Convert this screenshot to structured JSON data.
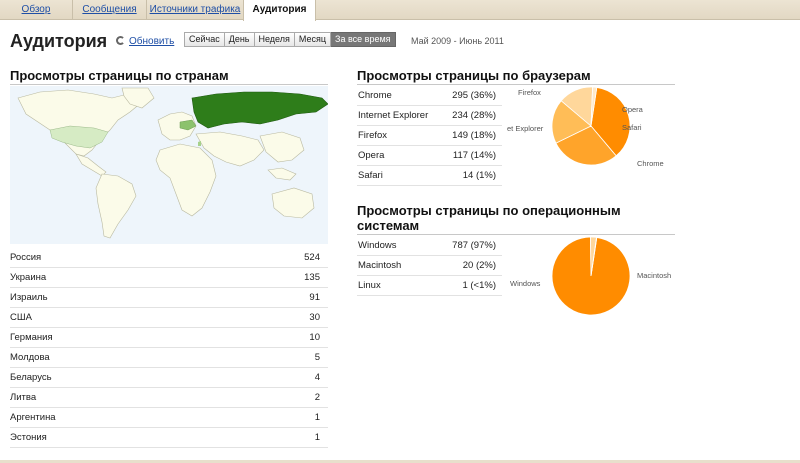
{
  "tabs": [
    {
      "label": "Обзор"
    },
    {
      "label": "Сообщения"
    },
    {
      "label": "Источники трафика"
    },
    {
      "label": "Аудитория"
    }
  ],
  "header": {
    "title": "Аудитория",
    "refresh_label": "Обновить",
    "ranges": [
      "Сейчас",
      "День",
      "Неделя",
      "Месяц",
      "За все время"
    ],
    "active_range": "За все время",
    "date_range": "Май 2009 - Июнь 2011"
  },
  "countries": {
    "title": "Просмотры страницы по странам",
    "highlight_color": "#2e7d1a",
    "rows": [
      {
        "name": "Россия",
        "value": "524"
      },
      {
        "name": "Украина",
        "value": "135"
      },
      {
        "name": "Израиль",
        "value": "91"
      },
      {
        "name": "США",
        "value": "30"
      },
      {
        "name": "Германия",
        "value": "10"
      },
      {
        "name": "Молдова",
        "value": "5"
      },
      {
        "name": "Беларусь",
        "value": "4"
      },
      {
        "name": "Литва",
        "value": "2"
      },
      {
        "name": "Аргентина",
        "value": "1"
      },
      {
        "name": "Эстония",
        "value": "1"
      }
    ]
  },
  "browsers": {
    "title": "Просмотры страницы по браузерам",
    "rows": [
      {
        "name": "Chrome",
        "value": "295 (36%)"
      },
      {
        "name": "Internet Explorer",
        "value": "234 (28%)"
      },
      {
        "name": "Firefox",
        "value": "149 (18%)"
      },
      {
        "name": "Opera",
        "value": "117 (14%)"
      },
      {
        "name": "Safari",
        "value": "14 (1%)"
      }
    ],
    "pie_labels": [
      "Firefox",
      "Opera",
      "Safari",
      "Chrome",
      "et Explorer"
    ],
    "chart_data": {
      "type": "pie",
      "slices": [
        {
          "name": "Chrome",
          "value": 295
        },
        {
          "name": "Internet Explorer",
          "value": 234
        },
        {
          "name": "Firefox",
          "value": 149
        },
        {
          "name": "Opera",
          "value": 117
        },
        {
          "name": "Safari",
          "value": 14
        }
      ],
      "colors": [
        "#ff8c00",
        "#ffa42a",
        "#ffbd57",
        "#ffd79b",
        "#ffe9c9"
      ]
    }
  },
  "os": {
    "title": "Просмотры страницы по операционным системам",
    "rows": [
      {
        "name": "Windows",
        "value": "787 (97%)"
      },
      {
        "name": "Macintosh",
        "value": "20 (2%)"
      },
      {
        "name": "Linux",
        "value": "1 (<1%)"
      }
    ],
    "pie_labels": [
      "Windows",
      "Macintosh"
    ],
    "chart_data": {
      "type": "pie",
      "slices": [
        {
          "name": "Windows",
          "value": 787
        },
        {
          "name": "Macintosh",
          "value": 20
        },
        {
          "name": "Linux",
          "value": 1
        }
      ],
      "colors": [
        "#ff8c00",
        "#ffd79b",
        "#ffe9c9"
      ]
    }
  }
}
